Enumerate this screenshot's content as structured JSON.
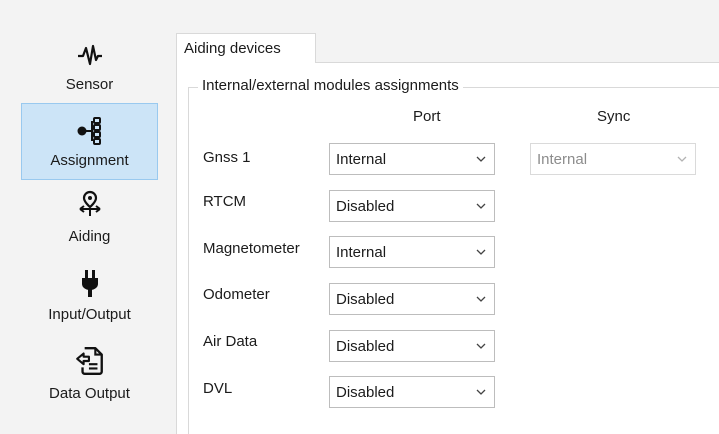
{
  "sidebar": {
    "items": [
      {
        "label": "Sensor",
        "icon": "waveform-icon"
      },
      {
        "label": "Assignment",
        "icon": "tree-nodes-icon",
        "selected": true
      },
      {
        "label": "Aiding",
        "icon": "map-pin-route-icon"
      },
      {
        "label": "Input/Output",
        "icon": "plug-icon"
      },
      {
        "label": "Data Output",
        "icon": "document-output-icon"
      }
    ]
  },
  "tab": {
    "label": "Aiding devices"
  },
  "group": {
    "title": "Internal/external modules assignments",
    "columns": {
      "port": "Port",
      "sync": "Sync"
    },
    "rows": [
      {
        "label": "Gnss 1",
        "port": "Internal",
        "sync": "Internal"
      },
      {
        "label": "RTCM",
        "port": "Disabled"
      },
      {
        "label": "Magnetometer",
        "port": "Internal"
      },
      {
        "label": "Odometer",
        "port": "Disabled"
      },
      {
        "label": "Air Data",
        "port": "Disabled"
      },
      {
        "label": "DVL",
        "port": "Disabled"
      }
    ]
  }
}
